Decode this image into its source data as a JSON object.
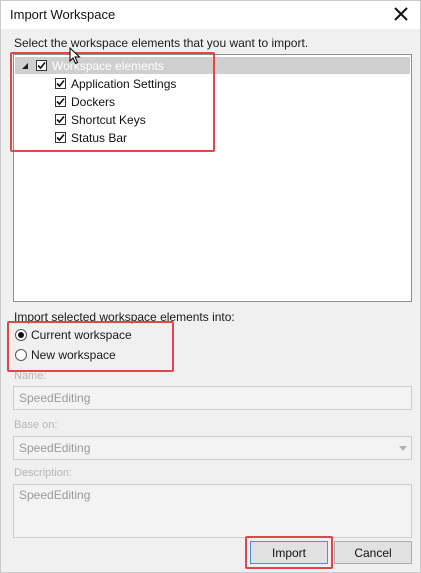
{
  "window": {
    "title": "Import Workspace",
    "close_icon": "close-icon"
  },
  "instruction": "Select the workspace elements that you want to import.",
  "tree": {
    "root": {
      "label": "Workspace elements",
      "checked": true,
      "expanded": true
    },
    "children": [
      {
        "label": "Application Settings",
        "checked": true
      },
      {
        "label": "Dockers",
        "checked": true
      },
      {
        "label": "Shortcut Keys",
        "checked": true
      },
      {
        "label": "Status Bar",
        "checked": true
      }
    ]
  },
  "import_into": {
    "label": "Import selected workspace elements into:",
    "options": [
      {
        "label": "Current workspace",
        "selected": true
      },
      {
        "label": "New workspace",
        "selected": false
      }
    ]
  },
  "fields": {
    "name_label": "Name:",
    "name_value": "SpeedEditing",
    "base_label": "Base on:",
    "base_value": "SpeedEditing",
    "description_label": "Description:",
    "description_value": "SpeedEditing"
  },
  "buttons": {
    "import": "Import",
    "cancel": "Cancel"
  },
  "colors": {
    "annotation": "#e04848",
    "tree_selection": "#cfcfcf"
  }
}
